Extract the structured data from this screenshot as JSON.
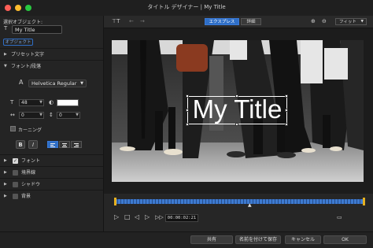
{
  "window": {
    "title": "タイトル デザイナー | My Title",
    "traffic_lights": [
      "#ff5f57",
      "#febc2e",
      "#28c840"
    ]
  },
  "left_panel": {
    "selected_object_label": "選択オブジェクト:",
    "object_name": "My Title",
    "object_icon": "text-icon",
    "object_tab": "オブジェクト",
    "sections": {
      "preset": "プリセット文字",
      "font_paragraph": "フォント/段落"
    },
    "font": {
      "family": "Helvetica Regular",
      "size": "48",
      "color": "#ffffff",
      "char_spacing": "0",
      "line_spacing": "0",
      "kerning_label": "カーニング"
    },
    "format": {
      "bold": "B",
      "italic": "I"
    },
    "effects": [
      {
        "label": "フォント",
        "checked": true
      },
      {
        "label": "境界線",
        "checked": false
      },
      {
        "label": "シャドウ",
        "checked": false
      },
      {
        "label": "背景",
        "checked": false
      }
    ]
  },
  "toolbar": {
    "express_label": "エクスプレス",
    "detail_label": "詳細",
    "zoom_label": "フィット",
    "accent": "#2f6fc7"
  },
  "preview": {
    "title_text": "My Title"
  },
  "playback": {
    "timecode": "00:00:02:21",
    "timeline_color": "#3d7ad0"
  },
  "buttons": {
    "share": "共有",
    "save_as": "名前を付けて保存",
    "cancel": "キャンセル",
    "ok": "OK"
  }
}
